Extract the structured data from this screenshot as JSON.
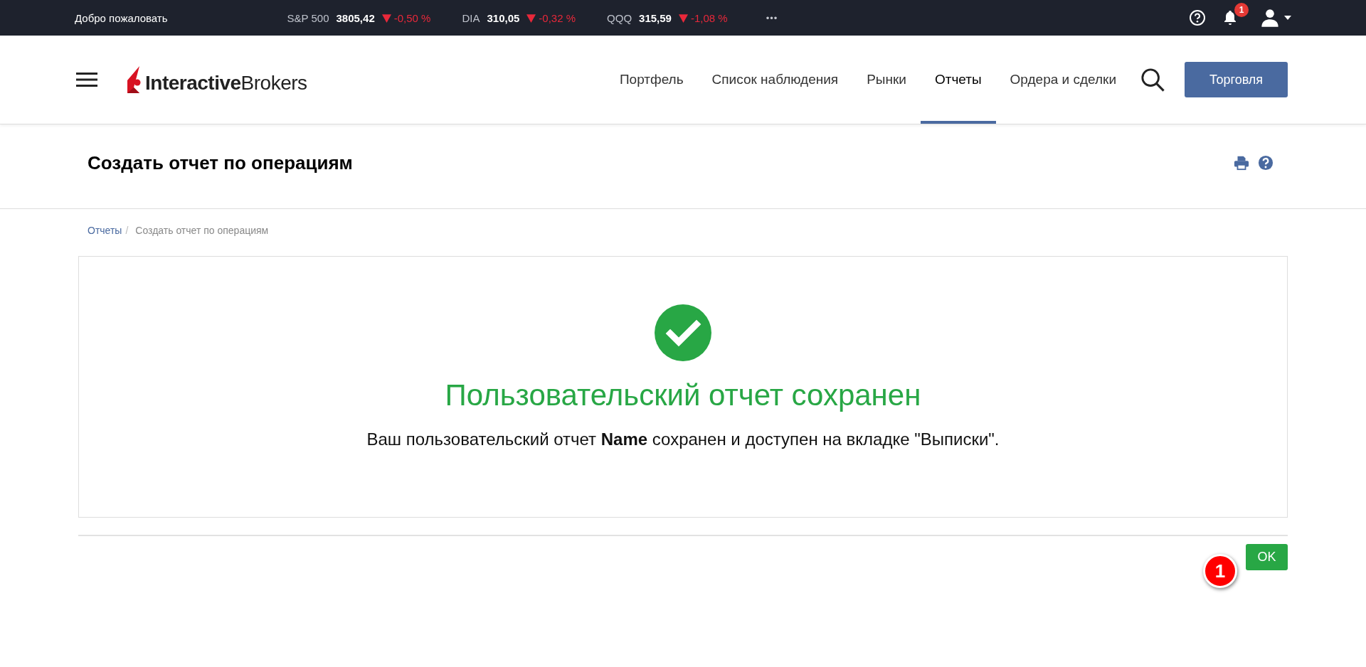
{
  "top_bar": {
    "welcome": "Добро пожаловать",
    "tickers": [
      {
        "symbol": "S&P 500",
        "value": "3805,42",
        "change": "-0,50 %",
        "kind": "down"
      },
      {
        "symbol": "DIA",
        "value": "310,05",
        "change": "-0,32 %",
        "kind": "down"
      },
      {
        "symbol": "QQQ",
        "value": "315,59",
        "change": "-1,08 %",
        "kind": "down"
      }
    ],
    "more": "•••",
    "notification_count": "1"
  },
  "header": {
    "logo": {
      "bold": "Interactive",
      "light": "Brokers"
    },
    "nav": [
      {
        "label": "Портфель",
        "selected": false
      },
      {
        "label": "Список наблюдения",
        "selected": false
      },
      {
        "label": "Рынки",
        "selected": false
      },
      {
        "label": "Отчеты",
        "selected": true
      },
      {
        "label": "Ордера и сделки",
        "selected": false
      }
    ],
    "trade_button": "Торговля"
  },
  "page": {
    "title": "Создать отчет по операциям",
    "breadcrumb_separator": "/",
    "breadcrumb": [
      {
        "label": "Отчеты",
        "link": true
      },
      {
        "label": "Создать отчет по операциям",
        "link": false
      }
    ]
  },
  "message": {
    "heading": "Пользовательский отчет сохранен",
    "text": "Ваш пользовательский отчет **Name** сохранен и доступен на вкладке \"Выписки\"."
  },
  "ok_button": "OK",
  "callout": "1"
}
